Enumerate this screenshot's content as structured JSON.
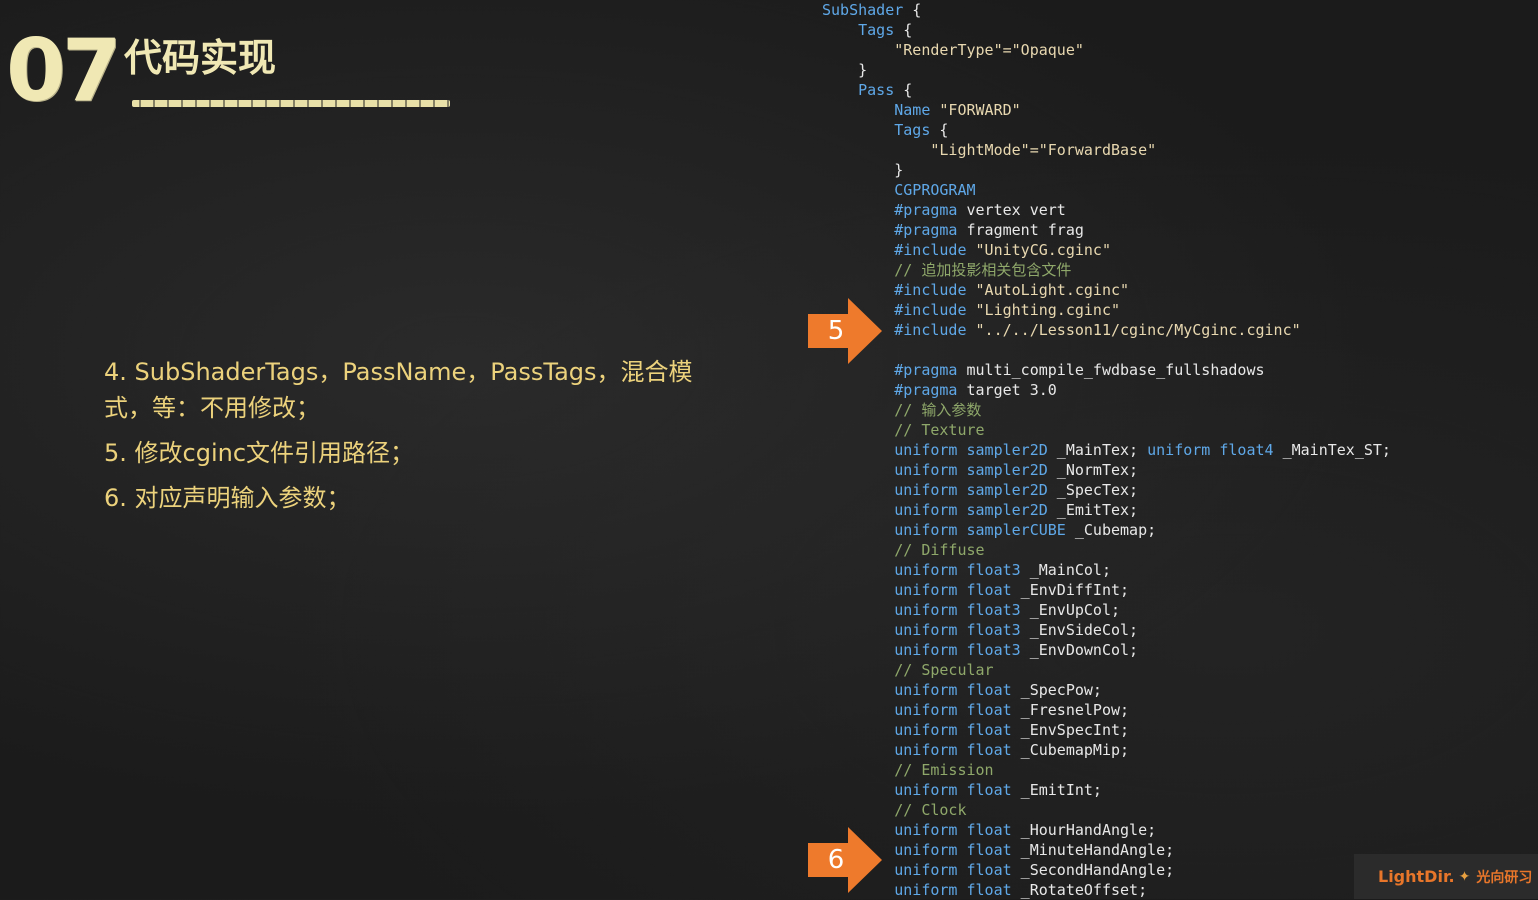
{
  "slide": {
    "number": "07",
    "title": "代码实现"
  },
  "bullets": [
    "4. SubShaderTags，PassName，PassTags，混合模式，等：不用修改；",
    "5. 修改cginc文件引用路径；",
    "6. 对应声明输入参数；"
  ],
  "markers": [
    {
      "label": "5"
    },
    {
      "label": "6"
    }
  ],
  "code_lines": [
    [
      {
        "t": "SubShader",
        "c": "kw"
      },
      {
        "t": " {",
        "c": "id"
      }
    ],
    [
      {
        "t": "    Tags",
        "c": "kw"
      },
      {
        "t": " {",
        "c": "id"
      }
    ],
    [
      {
        "t": "        \"RenderType\"=\"Opaque\"",
        "c": "str"
      }
    ],
    [
      {
        "t": "    }",
        "c": "id"
      }
    ],
    [
      {
        "t": "    Pass",
        "c": "kw"
      },
      {
        "t": " {",
        "c": "id"
      }
    ],
    [
      {
        "t": "        Name",
        "c": "kw"
      },
      {
        "t": " \"FORWARD\"",
        "c": "str"
      }
    ],
    [
      {
        "t": "        Tags",
        "c": "kw"
      },
      {
        "t": " {",
        "c": "id"
      }
    ],
    [
      {
        "t": "            \"LightMode\"=\"ForwardBase\"",
        "c": "str"
      }
    ],
    [
      {
        "t": "        }",
        "c": "id"
      }
    ],
    [
      {
        "t": "        CGPROGRAM",
        "c": "kw"
      }
    ],
    [
      {
        "t": "        #pragma",
        "c": "kw"
      },
      {
        "t": " vertex vert",
        "c": "id"
      }
    ],
    [
      {
        "t": "        #pragma",
        "c": "kw"
      },
      {
        "t": " fragment frag",
        "c": "id"
      }
    ],
    [
      {
        "t": "        #include",
        "c": "kw"
      },
      {
        "t": " \"UnityCG.cginc\"",
        "c": "str"
      }
    ],
    [
      {
        "t": "        // 追加投影相关包含文件",
        "c": "cm"
      }
    ],
    [
      {
        "t": "        #include",
        "c": "kw"
      },
      {
        "t": " \"AutoLight.cginc\"",
        "c": "str"
      }
    ],
    [
      {
        "t": "        #include",
        "c": "kw"
      },
      {
        "t": " \"Lighting.cginc\"",
        "c": "str"
      }
    ],
    [
      {
        "t": "        #include",
        "c": "kw"
      },
      {
        "t": " \"../../Lesson11/cginc/MyCginc.cginc\"",
        "c": "str"
      }
    ],
    [
      {
        "t": "",
        "c": "id"
      }
    ],
    [
      {
        "t": "        #pragma",
        "c": "kw"
      },
      {
        "t": " multi_compile_fwdbase_fullshadows",
        "c": "id"
      }
    ],
    [
      {
        "t": "        #pragma",
        "c": "kw"
      },
      {
        "t": " target 3.0",
        "c": "id"
      }
    ],
    [
      {
        "t": "        // 输入参数",
        "c": "cm"
      }
    ],
    [
      {
        "t": "        // Texture",
        "c": "cm"
      }
    ],
    [
      {
        "t": "        uniform",
        "c": "kw"
      },
      {
        "t": " sampler2D",
        "c": "kw"
      },
      {
        "t": " _MainTex; ",
        "c": "id"
      },
      {
        "t": "uniform",
        "c": "kw"
      },
      {
        "t": " float4",
        "c": "kw"
      },
      {
        "t": " _MainTex_ST;",
        "c": "id"
      }
    ],
    [
      {
        "t": "        uniform",
        "c": "kw"
      },
      {
        "t": " sampler2D",
        "c": "kw"
      },
      {
        "t": " _NormTex;",
        "c": "id"
      }
    ],
    [
      {
        "t": "        uniform",
        "c": "kw"
      },
      {
        "t": " sampler2D",
        "c": "kw"
      },
      {
        "t": " _SpecTex;",
        "c": "id"
      }
    ],
    [
      {
        "t": "        uniform",
        "c": "kw"
      },
      {
        "t": " sampler2D",
        "c": "kw"
      },
      {
        "t": " _EmitTex;",
        "c": "id"
      }
    ],
    [
      {
        "t": "        uniform",
        "c": "kw"
      },
      {
        "t": " samplerCUBE",
        "c": "kw"
      },
      {
        "t": " _Cubemap;",
        "c": "id"
      }
    ],
    [
      {
        "t": "        // Diffuse",
        "c": "cm"
      }
    ],
    [
      {
        "t": "        uniform",
        "c": "kw"
      },
      {
        "t": " float3",
        "c": "kw"
      },
      {
        "t": " _MainCol;",
        "c": "id"
      }
    ],
    [
      {
        "t": "        uniform",
        "c": "kw"
      },
      {
        "t": " float",
        "c": "kw"
      },
      {
        "t": " _EnvDiffInt;",
        "c": "id"
      }
    ],
    [
      {
        "t": "        uniform",
        "c": "kw"
      },
      {
        "t": " float3",
        "c": "kw"
      },
      {
        "t": " _EnvUpCol;",
        "c": "id"
      }
    ],
    [
      {
        "t": "        uniform",
        "c": "kw"
      },
      {
        "t": " float3",
        "c": "kw"
      },
      {
        "t": " _EnvSideCol;",
        "c": "id"
      }
    ],
    [
      {
        "t": "        uniform",
        "c": "kw"
      },
      {
        "t": " float3",
        "c": "kw"
      },
      {
        "t": " _EnvDownCol;",
        "c": "id"
      }
    ],
    [
      {
        "t": "        // Specular",
        "c": "cm"
      }
    ],
    [
      {
        "t": "        uniform",
        "c": "kw"
      },
      {
        "t": " float",
        "c": "kw"
      },
      {
        "t": " _SpecPow;",
        "c": "id"
      }
    ],
    [
      {
        "t": "        uniform",
        "c": "kw"
      },
      {
        "t": " float",
        "c": "kw"
      },
      {
        "t": " _FresnelPow;",
        "c": "id"
      }
    ],
    [
      {
        "t": "        uniform",
        "c": "kw"
      },
      {
        "t": " float",
        "c": "kw"
      },
      {
        "t": " _EnvSpecInt;",
        "c": "id"
      }
    ],
    [
      {
        "t": "        uniform",
        "c": "kw"
      },
      {
        "t": " float",
        "c": "kw"
      },
      {
        "t": " _CubemapMip;",
        "c": "id"
      }
    ],
    [
      {
        "t": "        // Emission",
        "c": "cm"
      }
    ],
    [
      {
        "t": "        uniform",
        "c": "kw"
      },
      {
        "t": " float",
        "c": "kw"
      },
      {
        "t": " _EmitInt;",
        "c": "id"
      }
    ],
    [
      {
        "t": "        // Clock",
        "c": "cm"
      }
    ],
    [
      {
        "t": "        uniform",
        "c": "kw"
      },
      {
        "t": " float",
        "c": "kw"
      },
      {
        "t": " _HourHandAngle;",
        "c": "id"
      }
    ],
    [
      {
        "t": "        uniform",
        "c": "kw"
      },
      {
        "t": " float",
        "c": "kw"
      },
      {
        "t": " _MinuteHandAngle;",
        "c": "id"
      }
    ],
    [
      {
        "t": "        uniform",
        "c": "kw"
      },
      {
        "t": " float",
        "c": "kw"
      },
      {
        "t": " _SecondHandAngle;",
        "c": "id"
      }
    ],
    [
      {
        "t": "        uniform",
        "c": "kw"
      },
      {
        "t": " float",
        "c": "kw"
      },
      {
        "t": " _RotateOffset;",
        "c": "id"
      }
    ]
  ],
  "brand": {
    "name": "LightDir.",
    "cn": "光向研习"
  },
  "colors": {
    "background": "#1b1b1b",
    "title": "#f0e8b4",
    "bullet_text": "#ecd27c",
    "keyword": "#5fa8e8",
    "string": "#e8d8b0",
    "comment": "#8fa86a",
    "marker": "#ee7a2c"
  }
}
